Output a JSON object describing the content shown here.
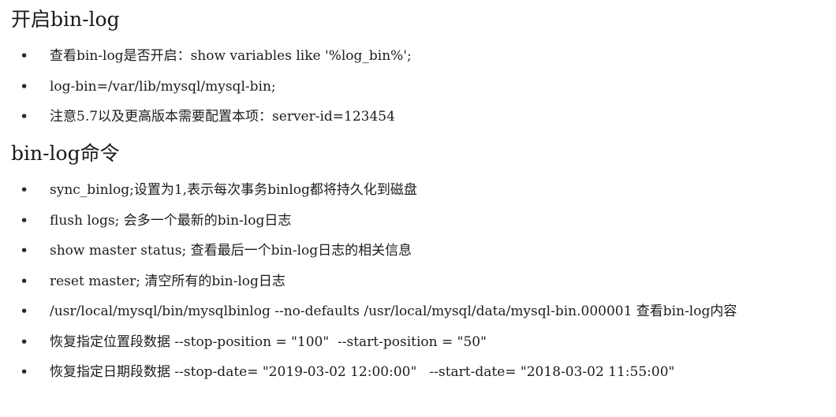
{
  "section1": {
    "title": "开启bin-log",
    "items": [
      "查看bin-log是否开启：show variables like '%log_bin%';",
      "log-bin=/var/lib/mysql/mysql-bin;",
      "注意5.7以及更高版本需要配置本项：server-id=123454"
    ]
  },
  "section2": {
    "title": "bin-log命令",
    "items": [
      "sync_binlog;设置为1,表示每次事务binlog都将持久化到磁盘",
      "flush logs; 会多一个最新的bin-log日志",
      "show master status; 查看最后一个bin-log日志的相关信息",
      "reset master; 清空所有的bin-log日志",
      "/usr/local/mysql/bin/mysqlbinlog --no-defaults /usr/local/mysql/data/mysql-bin.000001 查看bin-log内容",
      "恢复指定位置段数据 --stop-position = \"100\"  --start-position = \"50\"",
      "恢复指定日期段数据 --stop-date= \"2019-03-02 12:00:00\"   --start-date= \"2018-03-02 11:55:00\""
    ]
  },
  "bullet_symbol": "•"
}
